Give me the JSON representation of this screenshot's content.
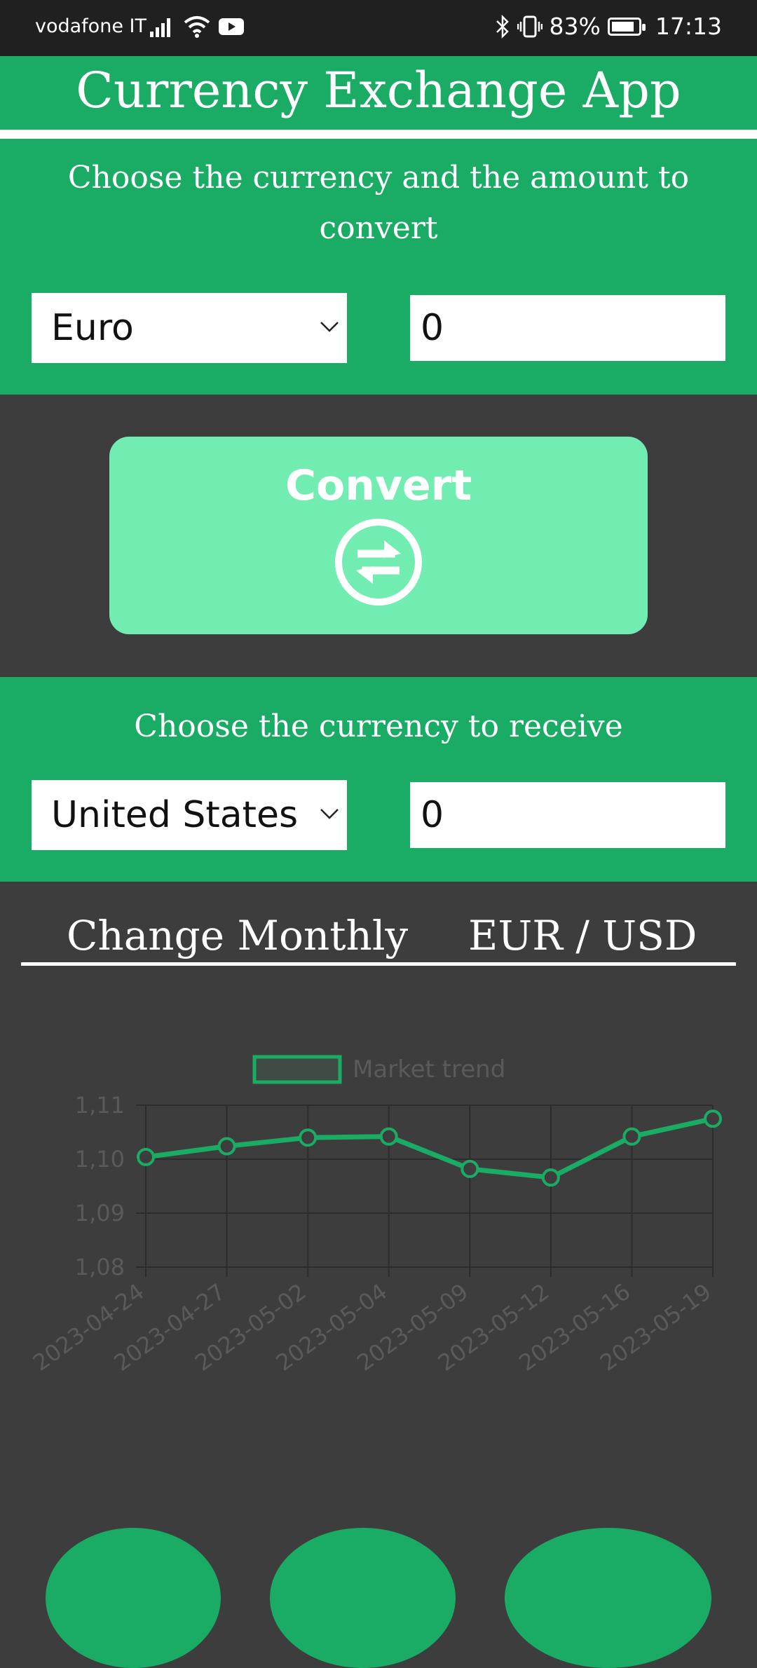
{
  "status_bar": {
    "carrier": "vodafone IT",
    "battery": "83%",
    "time": "17:13",
    "icons": [
      "signal-icon",
      "wifi-icon",
      "youtube-icon",
      "bluetooth-icon",
      "vibrate-icon",
      "battery-icon"
    ]
  },
  "app": {
    "title": "Currency Exchange App"
  },
  "from_section": {
    "title": "Choose the currency and the amount to convert",
    "currency": "Euro",
    "amount": "0"
  },
  "convert": {
    "label": "Convert",
    "icon": "swap-icon"
  },
  "to_section": {
    "title": "Choose the currency to receive",
    "currency": "United States",
    "amount": "0"
  },
  "tabs": {
    "monthly": "Change Monthly",
    "pair": "EUR / USD"
  },
  "colors": {
    "green": "#1aab64",
    "light_green": "#72edb2",
    "background": "#3d3d3d",
    "status_bar": "#202020"
  },
  "chart_data": {
    "type": "line",
    "legend": "Market trend",
    "legend_position": "top",
    "x": [
      "2023-04-24",
      "2023-04-27",
      "2023-05-02",
      "2023-05-04",
      "2023-05-09",
      "2023-05-12",
      "2023-05-16",
      "2023-05-19"
    ],
    "series": [
      {
        "name": "Market trend",
        "values": [
          1.1004,
          1.1024,
          1.104,
          1.1042,
          1.0982,
          1.0966,
          1.1042,
          1.1075
        ]
      }
    ],
    "y_ticks": [
      "1,11",
      "1,10",
      "1,09",
      "1,08"
    ],
    "ylim": [
      1.08,
      1.11
    ],
    "grid": true
  }
}
